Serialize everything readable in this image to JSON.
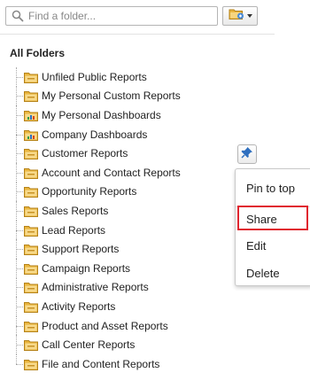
{
  "search": {
    "placeholder": "Find a folder..."
  },
  "tree": {
    "title": "All Folders",
    "items": [
      {
        "label": "Unfiled Public Reports",
        "icon": "folder-icon"
      },
      {
        "label": "My Personal Custom Reports",
        "icon": "folder-icon"
      },
      {
        "label": "My Personal Dashboards",
        "icon": "dashboard-folder-icon"
      },
      {
        "label": "Company Dashboards",
        "icon": "dashboard-folder-icon"
      },
      {
        "label": "Customer Reports",
        "icon": "folder-icon"
      },
      {
        "label": "Account and Contact Reports",
        "icon": "folder-icon"
      },
      {
        "label": "Opportunity Reports",
        "icon": "folder-icon"
      },
      {
        "label": "Sales Reports",
        "icon": "folder-icon"
      },
      {
        "label": "Lead Reports",
        "icon": "folder-icon"
      },
      {
        "label": "Support Reports",
        "icon": "folder-icon"
      },
      {
        "label": "Campaign Reports",
        "icon": "folder-icon"
      },
      {
        "label": "Administrative Reports",
        "icon": "folder-icon"
      },
      {
        "label": "Activity Reports",
        "icon": "folder-icon"
      },
      {
        "label": "Product and Asset Reports",
        "icon": "folder-icon"
      },
      {
        "label": "Call Center Reports",
        "icon": "folder-icon"
      },
      {
        "label": "File and Content Reports",
        "icon": "folder-icon"
      }
    ]
  },
  "menu": {
    "pin_to_top": "Pin to top",
    "share": "Share",
    "edit": "Edit",
    "delete": "Delete"
  },
  "colors": {
    "folder": "#e9b53f",
    "highlight": "#e0252f",
    "pin": "#2f6fbf"
  }
}
